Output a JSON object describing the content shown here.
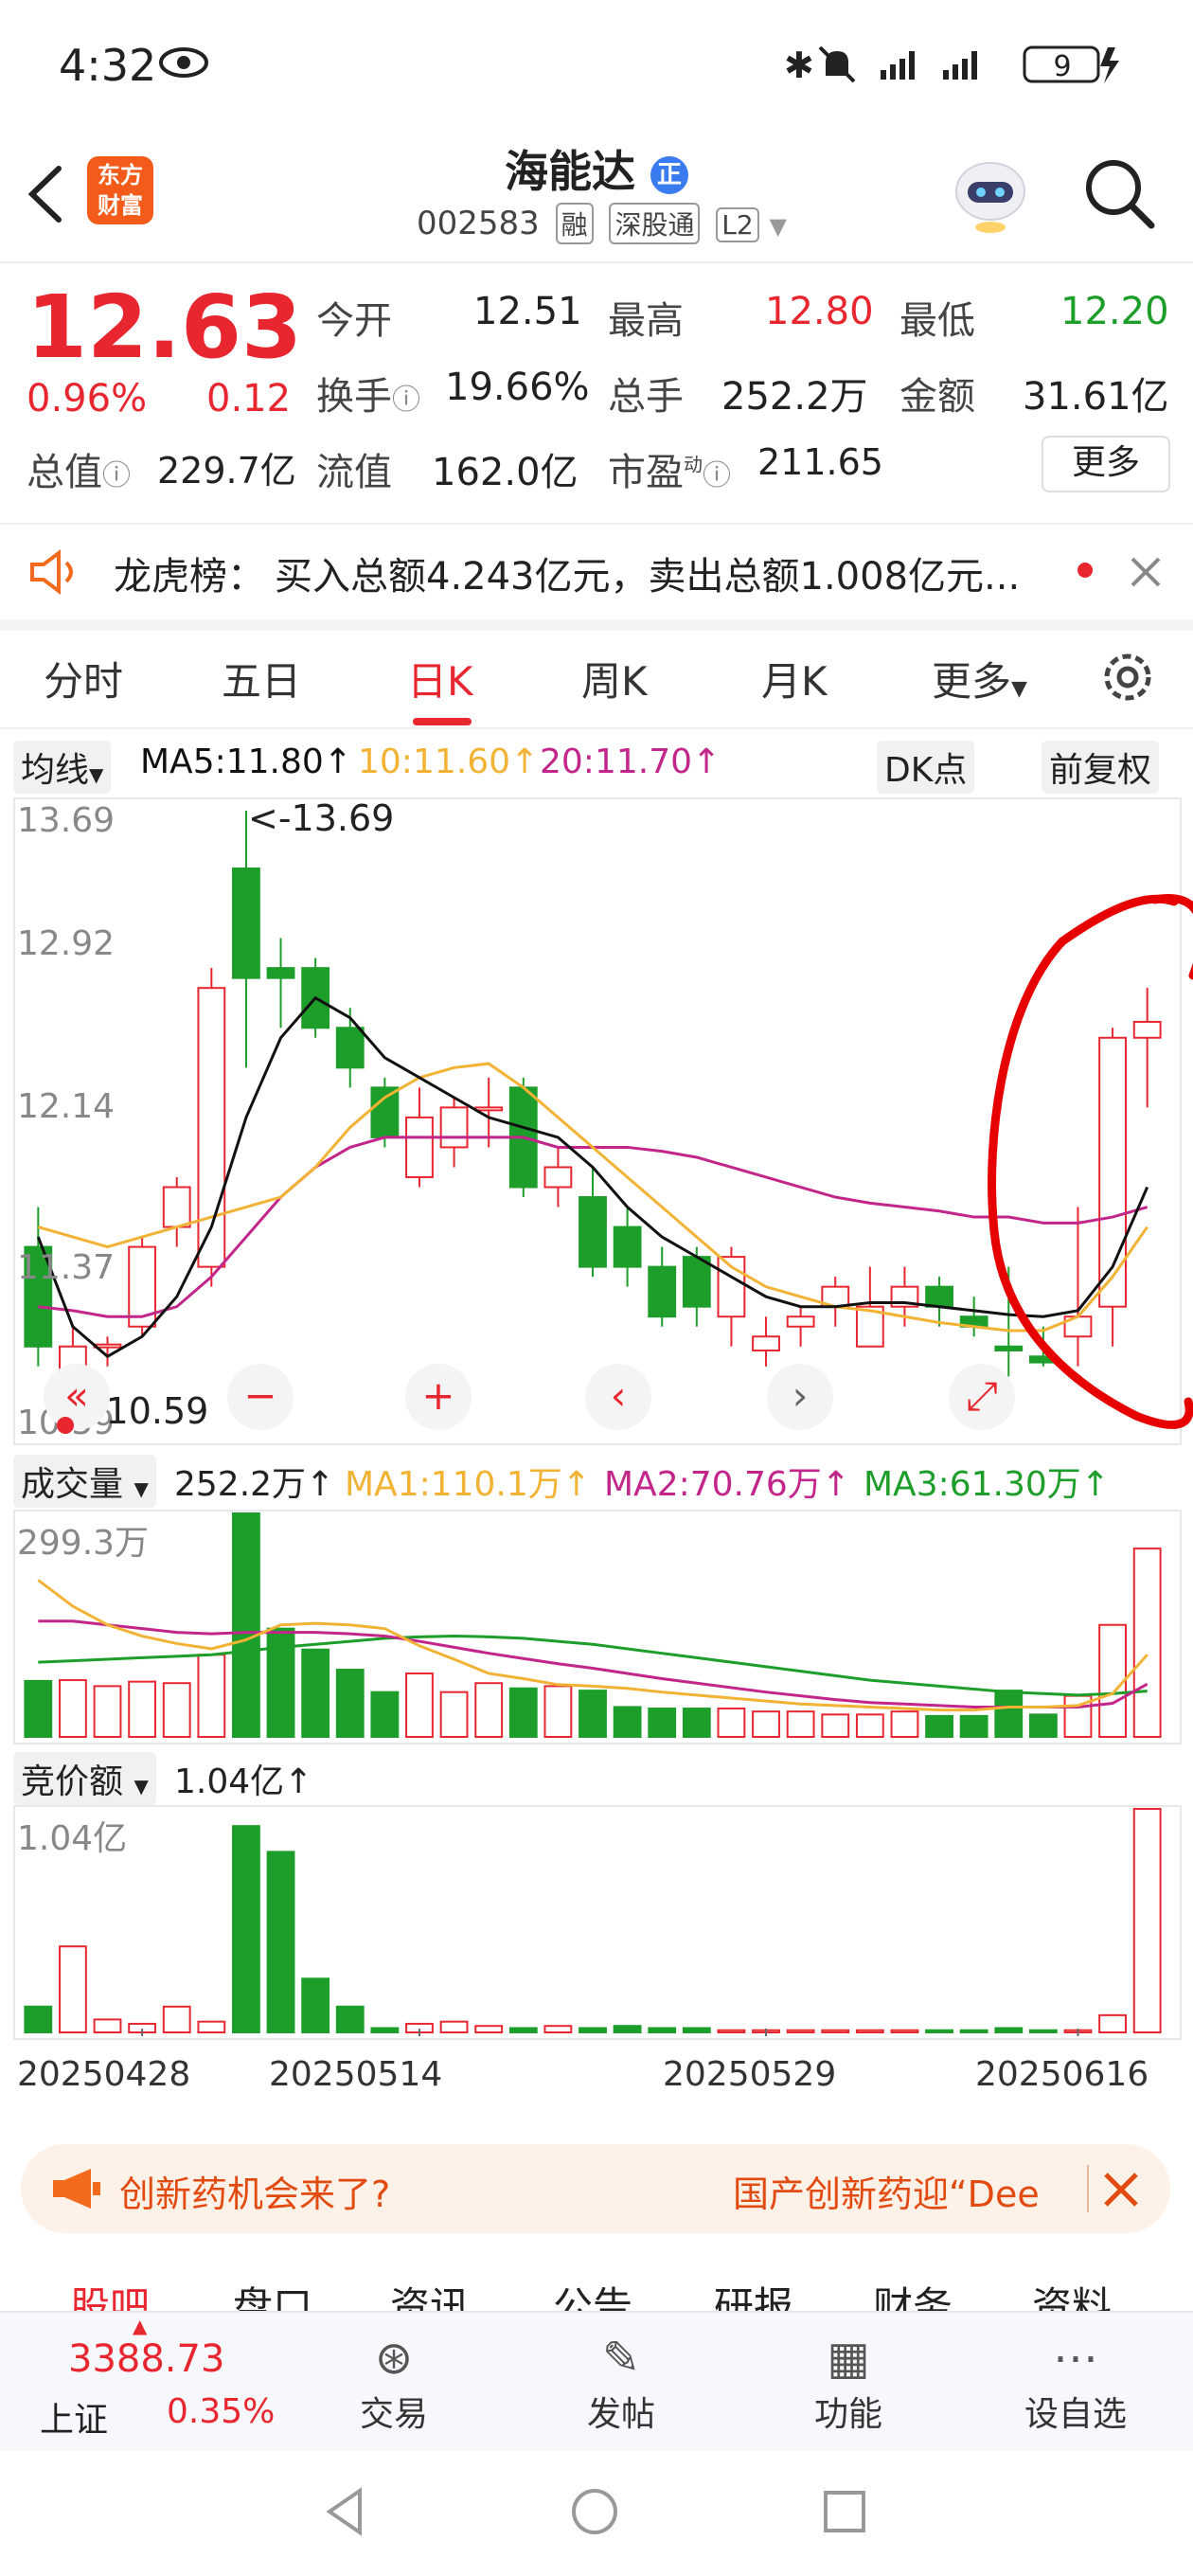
{
  "status_bar": {
    "time": "4:32",
    "battery": "9"
  },
  "header": {
    "title": "海能达",
    "title_badge": "正",
    "code": "002583",
    "tags": [
      "融",
      "深股通",
      "L2"
    ],
    "logo_line1": "东方",
    "logo_line2": "财富"
  },
  "quote": {
    "price": "12.63",
    "change_pct": "0.96%",
    "change": "0.12",
    "rows": [
      [
        {
          "label": "今开",
          "value": "12.51",
          "color": "#222"
        },
        {
          "label": "最高",
          "value": "12.80",
          "color": "#e8262f"
        },
        {
          "label": "最低",
          "value": "12.20",
          "color": "#1d9e2a"
        }
      ],
      [
        {
          "label": "换手",
          "value": "19.66%",
          "color": "#222"
        },
        {
          "label": "总手",
          "value": "252.2万",
          "color": "#222"
        },
        {
          "label": "金额",
          "value": "31.61亿",
          "color": "#222"
        }
      ],
      [
        {
          "label": "总值",
          "value": "229.7亿",
          "color": "#222"
        },
        {
          "label": "流值",
          "value": "162.0亿",
          "color": "#222"
        },
        {
          "label": "市盈",
          "value": "211.65",
          "color": "#222"
        }
      ]
    ],
    "pe_superscript": "动",
    "more_label": "更多"
  },
  "news": {
    "label": "龙虎榜：",
    "text": "买入总额4.243亿元，卖出总额1.008亿元..."
  },
  "tabs": [
    "分时",
    "五日",
    "日K",
    "周K",
    "月K",
    "更多"
  ],
  "active_tab": 2,
  "ma_bar": {
    "selector": "均线",
    "ma5": "MA5:11.80↑",
    "ma10": "10:11.60↑",
    "ma20": "20:11.70↑",
    "dk": "DK点",
    "adjust": "前复权"
  },
  "kline": {
    "y_labels": [
      "13.69",
      "12.92",
      "12.14",
      "11.37",
      "10.59"
    ],
    "high_note": "<-13.69",
    "low_note": "<-10.59"
  },
  "volume": {
    "selector": "成交量",
    "value": "252.2万↑",
    "ma1": "MA1:110.1万↑",
    "ma2": "MA2:70.76万↑",
    "ma3": "MA3:61.30万↑",
    "y_label": "299.3万"
  },
  "bid": {
    "selector": "竞价额",
    "value": "1.04亿↑",
    "y_label": "1.04亿"
  },
  "dates": [
    "20250428",
    "20250514",
    "20250529",
    "20250616"
  ],
  "banner": {
    "left": "创新药机会来了?",
    "right": "国产创新药迎“Dee"
  },
  "bottom_tabs_partial": [
    "股吧",
    "盘口",
    "资讯",
    "公告",
    "研报",
    "财务",
    "资料"
  ],
  "bottom_nav": {
    "index_value": "3388.73",
    "index_name": "上证",
    "index_change": "0.35%",
    "items": [
      "交易",
      "发帖",
      "功能",
      "设自选"
    ]
  },
  "colors": {
    "up": "#e8262f",
    "down": "#1d9e2a",
    "ma5": "#111111",
    "ma10": "#f2b233",
    "ma20": "#c2268a"
  },
  "chart_data": {
    "type": "candlestick",
    "open": [
      11.5,
      10.6,
      11.0,
      11.1,
      11.6,
      11.4,
      13.4,
      12.9,
      12.9,
      12.6,
      12.3,
      11.85,
      12.0,
      12.2,
      12.3,
      11.8,
      11.75,
      11.6,
      11.4,
      11.45,
      11.15,
      10.98,
      11.1,
      11.2,
      11.0,
      11.2,
      11.3,
      11.15,
      11.0,
      10.95,
      11.05,
      11.2,
      12.55
    ],
    "close": [
      11.0,
      11.0,
      11.01,
      11.5,
      11.8,
      12.8,
      12.85,
      12.85,
      12.6,
      12.4,
      12.05,
      12.15,
      12.2,
      12.2,
      11.8,
      11.9,
      11.4,
      11.4,
      11.15,
      11.2,
      11.45,
      11.05,
      11.15,
      11.3,
      11.2,
      11.3,
      11.2,
      11.1,
      10.98,
      10.92,
      11.15,
      12.55,
      12.63
    ],
    "high": [
      11.7,
      11.1,
      11.05,
      11.55,
      11.85,
      12.9,
      13.69,
      13.05,
      12.95,
      12.7,
      12.35,
      12.3,
      12.25,
      12.35,
      12.35,
      12.0,
      11.9,
      11.7,
      11.5,
      11.5,
      11.5,
      11.15,
      11.2,
      11.35,
      11.4,
      11.4,
      11.35,
      11.25,
      11.4,
      11.1,
      11.7,
      12.6,
      12.8
    ],
    "low": [
      10.9,
      10.59,
      10.9,
      11.05,
      11.5,
      11.3,
      12.4,
      12.6,
      12.55,
      12.3,
      12.0,
      11.8,
      11.9,
      12.0,
      11.75,
      11.7,
      11.35,
      11.3,
      11.1,
      11.1,
      11.0,
      10.9,
      11.0,
      11.1,
      11.0,
      11.1,
      11.1,
      11.05,
      10.85,
      10.9,
      10.9,
      11.0,
      12.2
    ],
    "ma5": [
      11.55,
      11.1,
      10.95,
      11.05,
      11.25,
      11.6,
      12.15,
      12.55,
      12.75,
      12.65,
      12.45,
      12.35,
      12.25,
      12.15,
      12.1,
      12.05,
      11.9,
      11.7,
      11.55,
      11.45,
      11.35,
      11.25,
      11.2,
      11.2,
      11.22,
      11.22,
      11.2,
      11.18,
      11.16,
      11.15,
      11.18,
      11.4,
      11.8
    ],
    "ma10": [
      11.6,
      11.55,
      11.5,
      11.55,
      11.6,
      11.65,
      11.7,
      11.75,
      11.9,
      12.1,
      12.25,
      12.35,
      12.4,
      12.42,
      12.3,
      12.15,
      12.0,
      11.85,
      11.7,
      11.55,
      11.4,
      11.3,
      11.25,
      11.2,
      11.18,
      11.15,
      11.12,
      11.1,
      11.08,
      11.08,
      11.15,
      11.35,
      11.6
    ],
    "ma20": [
      11.2,
      11.18,
      11.15,
      11.15,
      11.2,
      11.35,
      11.55,
      11.75,
      11.9,
      12.0,
      12.05,
      12.05,
      12.05,
      12.05,
      12.05,
      12.0,
      12.0,
      12.0,
      11.98,
      11.95,
      11.9,
      11.85,
      11.8,
      11.75,
      11.72,
      11.7,
      11.68,
      11.65,
      11.65,
      11.62,
      11.62,
      11.65,
      11.7
    ],
    "volume": [
      75,
      76,
      68,
      74,
      72,
      110,
      299.3,
      145,
      117,
      90,
      60,
      85,
      60,
      72,
      65,
      68,
      62,
      40,
      38,
      38,
      38,
      34,
      34,
      30,
      30,
      34,
      28,
      28,
      62,
      30,
      55,
      150,
      252.2
    ],
    "vol_ma1": [
      210,
      175,
      150,
      135,
      125,
      118,
      130,
      150,
      152,
      150,
      145,
      122,
      104,
      85,
      78,
      70,
      68,
      65,
      60,
      56,
      52,
      48,
      44,
      42,
      40,
      38,
      36,
      36,
      40,
      40,
      42,
      58,
      110.1
    ],
    "vol_ma2": [
      155,
      155,
      150,
      145,
      140,
      138,
      140,
      140,
      140,
      138,
      135,
      128,
      120,
      112,
      105,
      98,
      92,
      85,
      78,
      72,
      66,
      60,
      55,
      50,
      46,
      44,
      42,
      40,
      40,
      40,
      40,
      45,
      70.76
    ],
    "vol_ma3": [
      100,
      102,
      104,
      106,
      108,
      110,
      115,
      120,
      124,
      128,
      132,
      134,
      135,
      134,
      132,
      128,
      124,
      118,
      112,
      106,
      100,
      94,
      88,
      82,
      76,
      72,
      68,
      64,
      60,
      58,
      56,
      58,
      61.3
    ],
    "bid_amount": [
      0.12,
      0.4,
      0.06,
      0.04,
      0.12,
      0.05,
      0.96,
      0.84,
      0.25,
      0.12,
      0.02,
      0.04,
      0.05,
      0.03,
      0.02,
      0.03,
      0.02,
      0.03,
      0.02,
      0.02,
      0.01,
      0.01,
      0.01,
      0.01,
      0.01,
      0.01,
      0.01,
      0.01,
      0.02,
      0.01,
      0.01,
      0.08,
      1.04
    ],
    "y_range": [
      10.59,
      13.69
    ],
    "volume_max": 299.3,
    "bid_max": 1.04
  }
}
